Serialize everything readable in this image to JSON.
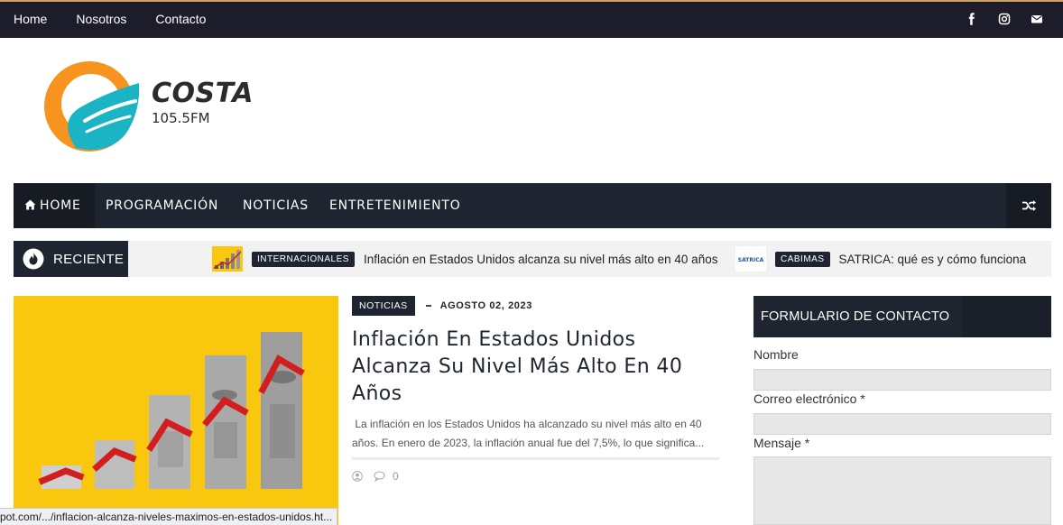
{
  "topbar": {
    "links": [
      "Home",
      "Nosotros",
      "Contacto"
    ],
    "social_icons": [
      "facebook-icon",
      "instagram-icon",
      "mail-icon"
    ]
  },
  "logo": {
    "word": "COSTA",
    "frequency": "105.5FM"
  },
  "main_nav": {
    "items": [
      "HOME",
      "PROGRAMACIÓN",
      "NOTICIAS",
      "ENTRETENIMIENTO"
    ],
    "home_icon": "home-icon",
    "shuffle_icon": "shuffle-icon"
  },
  "ticker": {
    "label": "RECIENTE",
    "items": [
      {
        "badge": "INTERNACIONALES",
        "title": "Inflación en Estados Unidos alcanza su nivel más alto en 40 años"
      },
      {
        "badge": "CABIMAS",
        "title": "SATRICA: qué es y cómo funciona",
        "thumb_text": "SATRICA"
      }
    ]
  },
  "article": {
    "category": "NOTICIAS",
    "date": "AGOSTO 02, 2023",
    "headline_lines": [
      "Inflación En Estados Unidos",
      "Alcanza Su Nivel Más Alto En 40",
      "Años"
    ],
    "excerpt_lines": [
      " La inflación en los Estados Unidos ha alcanzado su nivel más alto en 40",
      "años. En enero de 2023, la inflación anual fue del 7,5%, lo que significa..."
    ],
    "comments": "0"
  },
  "contact_form": {
    "title": "FORMULARIO DE CONTACTO",
    "fields": [
      "Nombre",
      "Correo electrónico *",
      "Mensaje *"
    ]
  },
  "status_url": "pot.com/.../inflacion-alcanza-niveles-maximos-en-estados-unidos.ht...",
  "colors": {
    "dark": "#1e2530",
    "topbar": "#1d1c2a",
    "accent_yellow": "#f9c80e",
    "logo_orange": "#f7931e",
    "logo_teal": "#1bb4c4"
  }
}
